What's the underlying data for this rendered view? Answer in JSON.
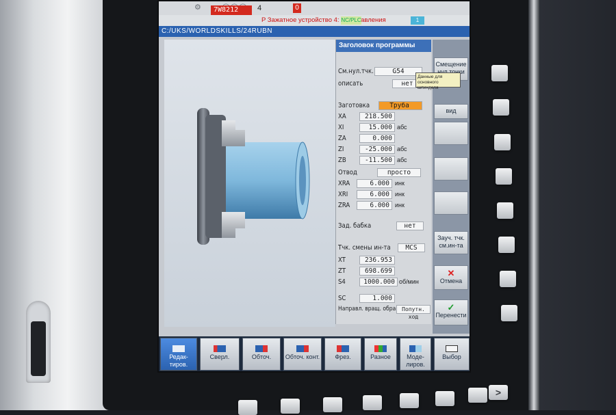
{
  "topbar": {
    "channel": "7W8212",
    "count": "4",
    "alarm_no": "0"
  },
  "alarm": {
    "text": "P Зажатное устройство 4: спад давления",
    "nc_icon": "NC/PLC",
    "channel_icon": "1"
  },
  "path": "C:/UKS/WORLDSKILLS/24RUBN",
  "form": {
    "title": "Заголовок программы",
    "rows": [
      {
        "label": "См.нул.тчк.",
        "value": "G54",
        "unit": ""
      },
      {
        "label": "описать",
        "value": "нет",
        "unit": ""
      },
      {
        "label": "Заготовка",
        "value": "Труба",
        "unit": ""
      },
      {
        "label": "XA",
        "value": "218.500",
        "unit": ""
      },
      {
        "label": "XI",
        "value": "15.000",
        "unit": "абс"
      },
      {
        "label": "ZA",
        "value": "0.000",
        "unit": ""
      },
      {
        "label": "ZI",
        "value": "-25.000",
        "unit": "абс"
      },
      {
        "label": "ZB",
        "value": "-11.500",
        "unit": "абс"
      },
      {
        "label": "Отвод",
        "value": "просто",
        "unit": ""
      },
      {
        "label": "XRA",
        "value": "6.000",
        "unit": "инк"
      },
      {
        "label": "XRI",
        "value": "6.000",
        "unit": "инк"
      },
      {
        "label": "ZRA",
        "value": "6.000",
        "unit": "инк"
      },
      {
        "label": "Зад. бабка",
        "value": "нет",
        "unit": ""
      },
      {
        "label": "Тчк. смены ин-та",
        "value": "MCS",
        "unit": ""
      },
      {
        "label": "XT",
        "value": "236.953",
        "unit": ""
      },
      {
        "label": "ZT",
        "value": "698.699",
        "unit": ""
      },
      {
        "label": "S4",
        "value": "1000.000",
        "unit": "об/мин"
      },
      {
        "label": "SC",
        "value": "1.000",
        "unit": ""
      },
      {
        "label": "Направл. вращ. обра",
        "value": "Попутн. ход",
        "unit": ""
      }
    ]
  },
  "tooltip": "Данные для основного шпинделя",
  "vertical_softkeys": {
    "offset": "Смещение нул.точки",
    "view": "вид",
    "teach": "Зауч. тчк. см.ин-та",
    "cancel": "Отмена",
    "accept": "Перенести"
  },
  "horizontal_softkeys": {
    "edit": "Редак-тиров.",
    "drill": "Сверл.",
    "turn": "Обточ.",
    "contour_turn": "Обточ. конт.",
    "mill": "Фрез.",
    "misc": "Разное",
    "simulate": "Моде-лиров.",
    "select": "Выбор"
  },
  "colors": {
    "accent_blue": "#2b62b0",
    "field_orange": "#f39a27",
    "alarm_red": "#d32a1f",
    "part_blue": "#7fb8dc"
  }
}
